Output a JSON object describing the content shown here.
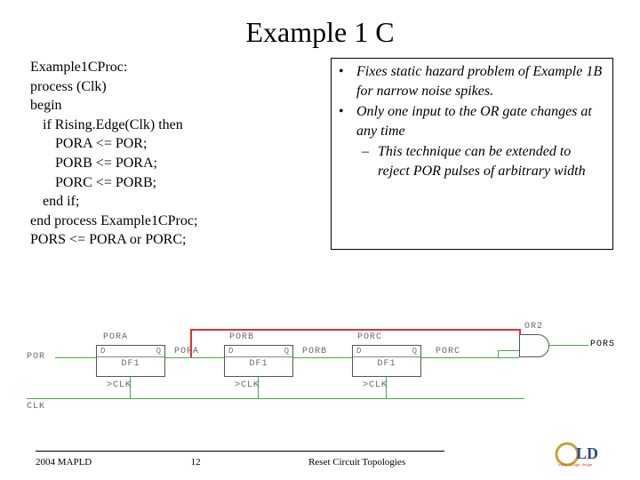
{
  "title": "Example 1 C",
  "code": {
    "l1": "Example1CProc:",
    "l2": "process (Clk)",
    "l3": "begin",
    "l4": "if Rising.Edge(Clk) then",
    "l5": "PORA <= POR;",
    "l6": "PORB <= PORA;",
    "l7": "PORC <= PORB;",
    "l8": "end if;",
    "l9": "end process Example1CProc;",
    "l10": "PORS <= PORA or PORC;"
  },
  "notes": {
    "b1": "Fixes static hazard problem of Example 1B for narrow noise spikes.",
    "b2": "Only one input to the OR gate changes at any time",
    "sub1": "This technique can be extended to reject POR pulses of arbitrary width"
  },
  "diagram": {
    "input": "POR",
    "clk": "CLK",
    "ff1": "DF1",
    "ff2": "DF1",
    "ff3": "DF1",
    "sig_a": "PORA",
    "sig_b": "PORB",
    "sig_c": "PORC",
    "out": "PORS",
    "or": "OR2"
  },
  "footer": {
    "left": "2004 MAPLD",
    "page": "12",
    "right": "Reset Circuit Topologies",
    "logo_sub": "office of logic design"
  }
}
